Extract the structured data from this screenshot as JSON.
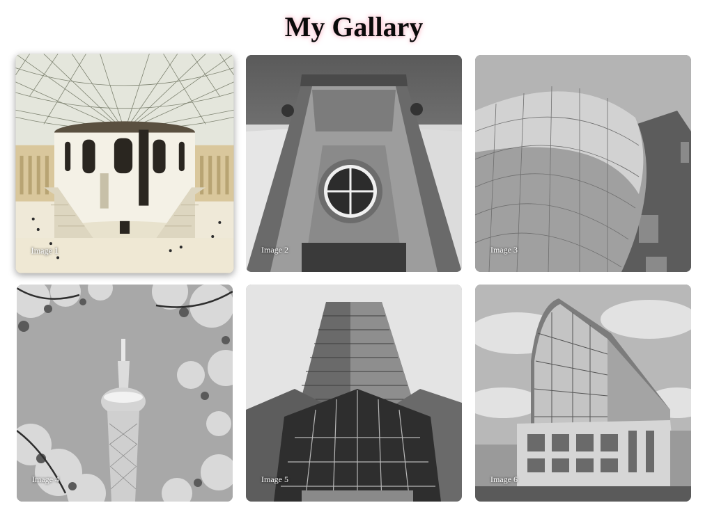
{
  "page": {
    "title": "My Gallary"
  },
  "gallery": {
    "items": [
      {
        "caption": "Image 1",
        "subject": "glass-roof atrium",
        "grayscale": false
      },
      {
        "caption": "Image 2",
        "subject": "stone facade with round window",
        "grayscale": true
      },
      {
        "caption": "Image 3",
        "subject": "curved metal panel building",
        "grayscale": true
      },
      {
        "caption": "Image 4",
        "subject": "tower framed by blossoms",
        "grayscale": true
      },
      {
        "caption": "Image 5",
        "subject": "skyscraper from below",
        "grayscale": true
      },
      {
        "caption": "Image 6",
        "subject": "curved glass office building",
        "grayscale": true
      }
    ]
  },
  "colors": {
    "title_glow": "#f7b8c8",
    "caption_text": "#ffffff"
  }
}
